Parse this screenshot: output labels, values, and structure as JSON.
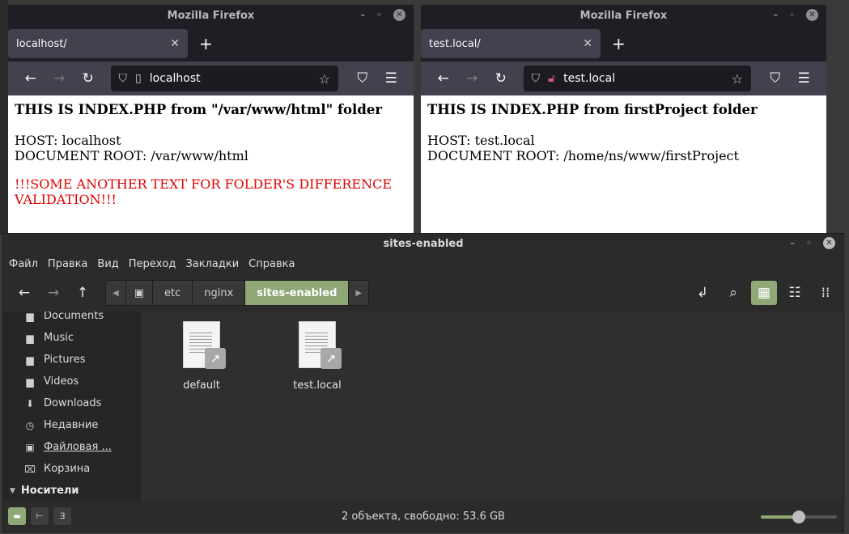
{
  "browser_left": {
    "window_title": "Mozilla Firefox",
    "tab_label": "localhost/",
    "url": "localhost",
    "heading": "THIS IS INDEX.PHP from \"/var/www/html\" folder",
    "host_line": "HOST: localhost",
    "docroot_line": "DOCUMENT ROOT: /var/www/html",
    "extra_text": "!!!SOME ANOTHER TEXT FOR FOLDER'S DIFFERENCE VALIDATION!!!"
  },
  "browser_right": {
    "window_title": "Mozilla Firefox",
    "tab_label": "test.local/",
    "url": "test.local",
    "heading": "THIS IS INDEX.PHP from firstProject folder",
    "host_line": "HOST: test.local",
    "docroot_line": "DOCUMENT ROOT: /home/ns/www/firstProject"
  },
  "file_manager": {
    "window_title": "sites-enabled",
    "menu": [
      "Файл",
      "Правка",
      "Вид",
      "Переход",
      "Закладки",
      "Справка"
    ],
    "breadcrumb": [
      "etc",
      "nginx",
      "sites-enabled"
    ],
    "sidebar": [
      {
        "label": "Documents",
        "icon": "folder-icon"
      },
      {
        "label": "Music",
        "icon": "folder-icon"
      },
      {
        "label": "Pictures",
        "icon": "folder-icon"
      },
      {
        "label": "Videos",
        "icon": "folder-icon"
      },
      {
        "label": "Downloads",
        "icon": "download-icon"
      },
      {
        "label": "Недавние",
        "icon": "clock-icon"
      },
      {
        "label": "Файловая ...",
        "icon": "drive-icon"
      },
      {
        "label": "Корзина",
        "icon": "trash-icon"
      }
    ],
    "devices_header": "Носители",
    "files": [
      {
        "name": "default"
      },
      {
        "name": "test.local"
      }
    ],
    "status": "2 объекта, свободно: 53.6 GB",
    "zoom_level": 0.5
  },
  "colors": {
    "accent": "#8fa876",
    "link_red": "#dd0000"
  }
}
